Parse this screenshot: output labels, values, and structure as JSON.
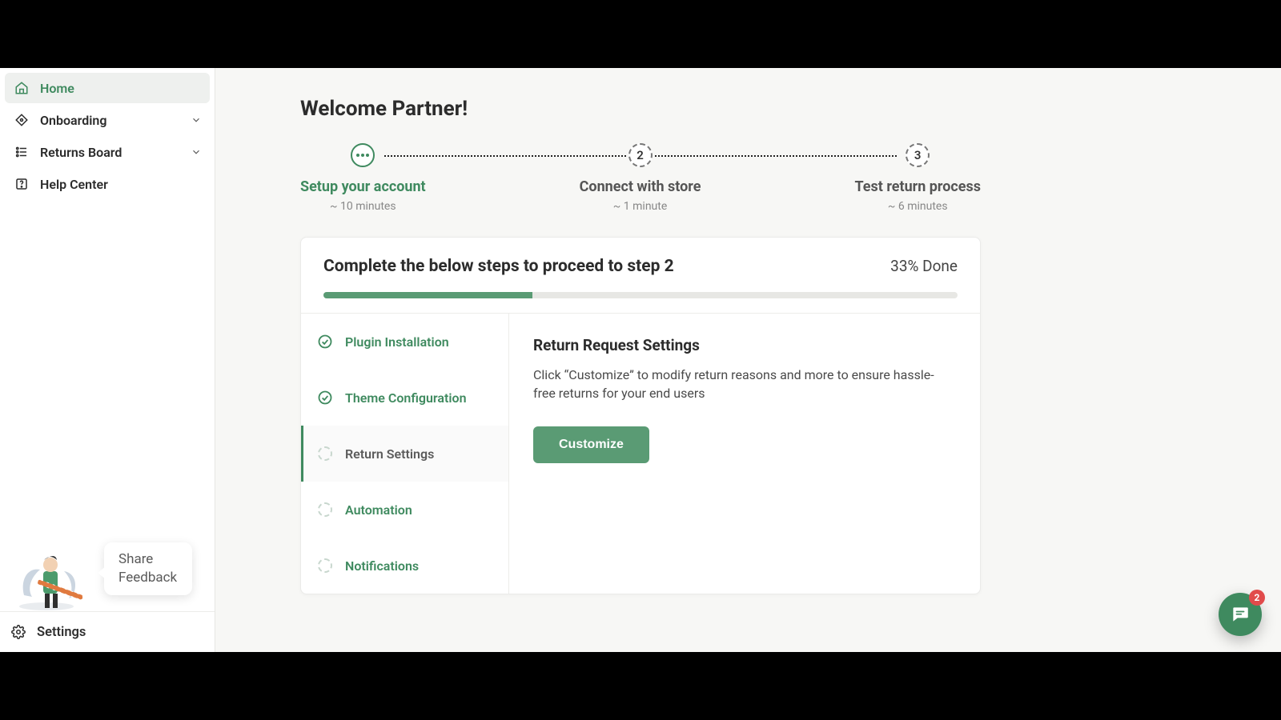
{
  "sidebar": {
    "items": [
      {
        "label": "Home"
      },
      {
        "label": "Onboarding"
      },
      {
        "label": "Returns Board"
      },
      {
        "label": "Help Center"
      }
    ],
    "feedback_line1": "Share",
    "feedback_line2": "Feedback",
    "settings_label": "Settings"
  },
  "header": {
    "welcome": "Welcome Partner!"
  },
  "stepper": {
    "steps": [
      {
        "title": "Setup your account",
        "time": "~ 10 minutes"
      },
      {
        "title": "Connect with store",
        "time": "~ 1 minute",
        "num": "2"
      },
      {
        "title": "Test return process",
        "time": "~ 6 minutes",
        "num": "3"
      }
    ]
  },
  "progress": {
    "title": "Complete the below steps to proceed to step 2",
    "pct_label": "33% Done",
    "pct_value": 33
  },
  "tasks": [
    {
      "label": "Plugin Installation",
      "state": "done"
    },
    {
      "label": "Theme Configuration",
      "state": "done"
    },
    {
      "label": "Return Settings",
      "state": "current"
    },
    {
      "label": "Automation",
      "state": "todo"
    },
    {
      "label": "Notifications",
      "state": "todo"
    }
  ],
  "detail": {
    "title": "Return Request Settings",
    "desc": "Click “Customize” to modify return reasons and more to ensure hassle-free returns for your end users",
    "button": "Customize"
  },
  "chat": {
    "badge": "2"
  },
  "colors": {
    "accent": "#3f8a5f",
    "accent_fill": "#5a9b74"
  }
}
